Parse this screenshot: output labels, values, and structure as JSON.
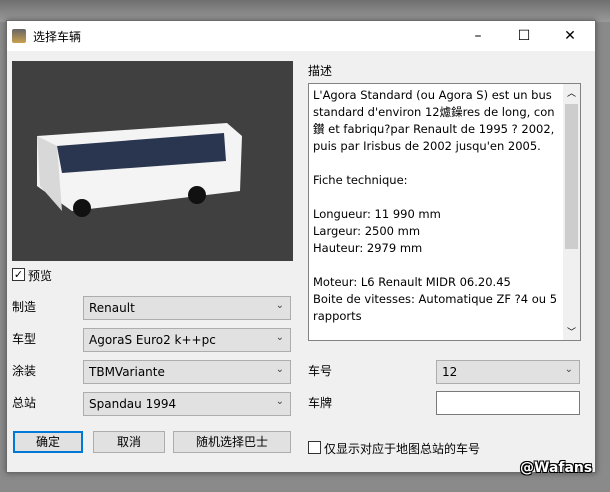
{
  "window": {
    "title": "选择车辆",
    "minimize": "–",
    "maximize": "☐",
    "close": "✕"
  },
  "preview": {
    "checkbox_label": "预览",
    "checked": true
  },
  "fields": [
    {
      "label": "制造",
      "value": "Renault"
    },
    {
      "label": "车型",
      "value": "AgoraS Euro2 k++pc"
    },
    {
      "label": "涂装",
      "value": "TBMVariante"
    },
    {
      "label": "总站",
      "value": "Spandau 1994"
    }
  ],
  "buttons": {
    "ok": "确定",
    "cancel": "取消",
    "random": "随机选择巴士"
  },
  "description": {
    "label": "描述",
    "text": "L'Agora Standard (ou Agora S) est un bus standard d'environ 12爈鐰res de long, con鑚 et fabriqu?par Renault de 1995 ? 2002, puis par Irisbus de 2002 jusqu'en 2005.\n\nFiche technique:\n\nLongueur: 11 990 mm\nLargeur: 2500 mm\nHauteur: 2979 mm\n\nMoteur: L6 Renault MIDR 06.20.45\nBoite de vitesses: Automatique ZF ?4 ou 5 rapports"
  },
  "vehicle_number": {
    "label": "车号",
    "value": "12"
  },
  "plate": {
    "label": "车牌",
    "value": ""
  },
  "filter_checkbox": {
    "label": "仅显示对应于地图总站的车号",
    "checked": false
  },
  "watermark": "@Wafans"
}
